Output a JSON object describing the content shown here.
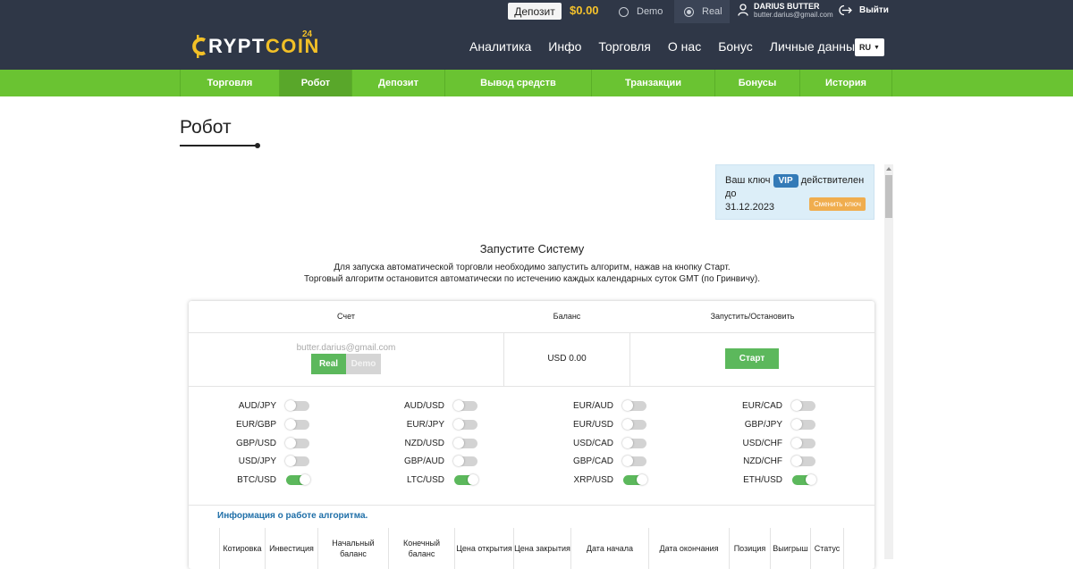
{
  "topbar": {
    "deposit_label": "Депозит",
    "balance": "$0.00",
    "mode_demo": "Demo",
    "mode_real": "Real",
    "user_name": "DARIUS BUTTER",
    "user_email": "butter.darius@gmail.com",
    "logout_label": "Выйти"
  },
  "header": {
    "logo_c": "C",
    "logo_ryp": "RYPT",
    "logo_coin": "COIN",
    "logo_sup": "24",
    "nav": [
      "Аналитика",
      "Инфо",
      "Торговля",
      "О нас",
      "Бонус",
      "Личные данные"
    ],
    "lang": "RU"
  },
  "subnav": {
    "tabs": [
      "Торговля",
      "Робот",
      "Депозит",
      "Вывод средств",
      "Транзакции",
      "Бонусы",
      "История"
    ],
    "active": 1
  },
  "page": {
    "title": "Робот"
  },
  "vip": {
    "prefix": "Ваш ключ",
    "badge": "VIP",
    "suffix": "действителен до",
    "date": "31.12.2023",
    "change_label": "Сменить ключ"
  },
  "system": {
    "title": "Запустите Систему",
    "line1": "Для запуска автоматической торговли необходимо запустить алгоритм, нажав на кнопку Старт.",
    "line2": "Торговый алгоритм остановится автоматически по истечению каждых календарных суток GMT (по Гринвичу)."
  },
  "account_table": {
    "col_account": "Счет",
    "col_balance": "Баланс",
    "col_action": "Запустить/Остановить",
    "email": "butter.darius@gmail.com",
    "real_label": "Real",
    "demo_label": "Demo",
    "balance_value": "USD 0.00",
    "start_label": "Старт"
  },
  "pairs": [
    [
      {
        "name": "AUD/JPY",
        "on": false
      },
      {
        "name": "EUR/GBP",
        "on": false
      },
      {
        "name": "GBP/USD",
        "on": false
      },
      {
        "name": "USD/JPY",
        "on": false
      },
      {
        "name": "BTC/USD",
        "on": true
      }
    ],
    [
      {
        "name": "AUD/USD",
        "on": false
      },
      {
        "name": "EUR/JPY",
        "on": false
      },
      {
        "name": "NZD/USD",
        "on": false
      },
      {
        "name": "GBP/AUD",
        "on": false
      },
      {
        "name": "LTC/USD",
        "on": true
      }
    ],
    [
      {
        "name": "EUR/AUD",
        "on": false
      },
      {
        "name": "EUR/USD",
        "on": false
      },
      {
        "name": "USD/CAD",
        "on": false
      },
      {
        "name": "GBP/CAD",
        "on": false
      },
      {
        "name": "XRP/USD",
        "on": true
      }
    ],
    [
      {
        "name": "EUR/CAD",
        "on": false
      },
      {
        "name": "GBP/JPY",
        "on": false
      },
      {
        "name": "USD/CHF",
        "on": false
      },
      {
        "name": "NZD/CHF",
        "on": false
      },
      {
        "name": "ETH/USD",
        "on": true
      }
    ]
  ],
  "info": {
    "title": "Информация о работе алгоритма.",
    "columns": [
      "Котировка",
      "Инвестиция",
      "Начальный баланс",
      "Конечный баланс",
      "Цена открытия",
      "Цена закрытия",
      "Дата начала",
      "Дата окончания",
      "Позиция",
      "Выигрыш",
      "Статус"
    ]
  }
}
